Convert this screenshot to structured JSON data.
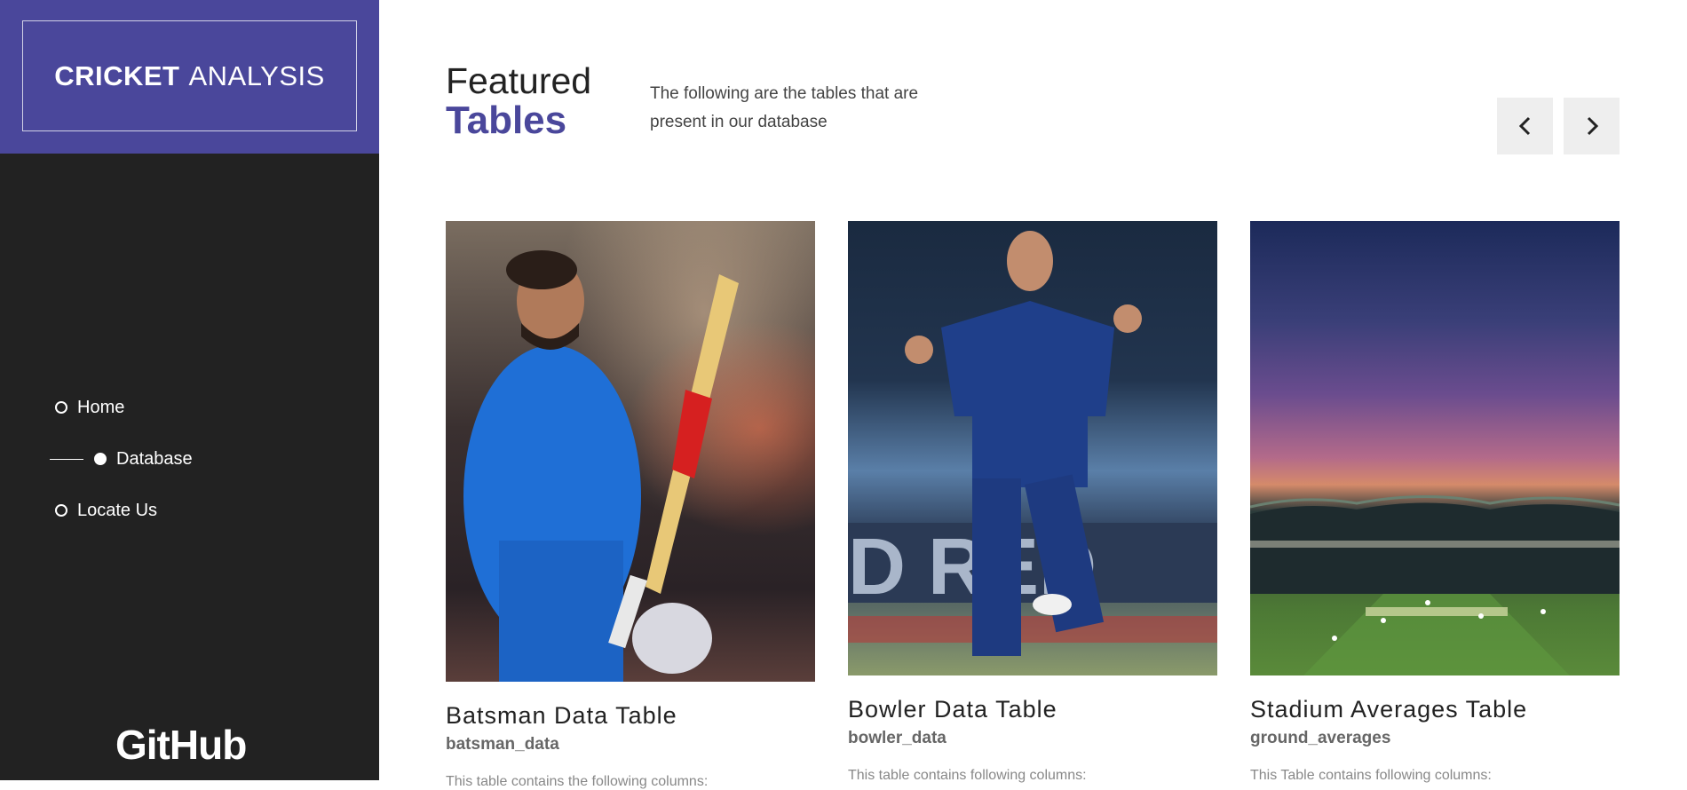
{
  "sidebar": {
    "brand_bold": "CRICKET",
    "brand_light": "ANALYSIS",
    "nav": [
      {
        "label": "Home",
        "active": false
      },
      {
        "label": "Database",
        "active": true
      },
      {
        "label": "Locate Us",
        "active": false
      }
    ],
    "github_label": "GitHub"
  },
  "header": {
    "title_line1": "Featured",
    "title_line2": "Tables",
    "intro": "The following are the tables that are present in our database"
  },
  "controls": {
    "prev_icon": "chevron-left-icon",
    "next_icon": "chevron-right-icon"
  },
  "cards": [
    {
      "title": "Batsman Data Table",
      "subtitle": "batsman_data",
      "description": "This table contains the following columns:"
    },
    {
      "title": "Bowler Data Table",
      "subtitle": "bowler_data",
      "description": "This table contains following columns:"
    },
    {
      "title": "Stadium Averages Table",
      "subtitle": "ground_averages",
      "description": "This Table contains following columns:"
    }
  ],
  "colors": {
    "brand": "#4a479b",
    "sidebar_bg": "#222222"
  }
}
